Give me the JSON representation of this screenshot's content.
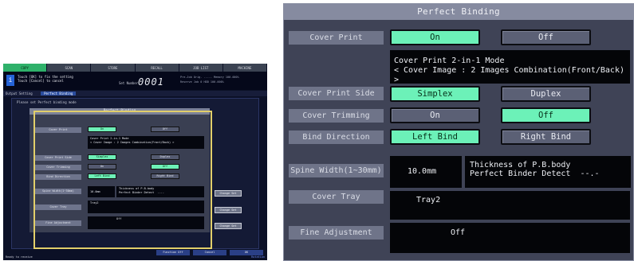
{
  "mini": {
    "tabs": [
      {
        "label": "COPY",
        "active": true
      },
      {
        "label": "SCAN",
        "active": false
      },
      {
        "label": "STORE",
        "active": false
      },
      {
        "label": "RECALL",
        "active": false
      },
      {
        "label": "JOB LIST",
        "active": false
      },
      {
        "label": "MACHINE",
        "active": false
      }
    ],
    "message_line1": "Touch [OK] to fix the setting",
    "message_line2": "Touch [Cancel] to cancel",
    "set_number_label": "Set Number",
    "set_number": "0001",
    "stat1": "Pre-Job Orig. -----   Memory   100.000%",
    "stat2": "Reserve Job     0  HDD      100.000%",
    "breadcrumb_parent": "Output Setting",
    "breadcrumb_current": "Perfect Binding",
    "hint": "Please set Perfect binding mode",
    "dialog_title": "Perfect Binding",
    "cover_print_label": "Cover Print",
    "on": "On",
    "off": "Off",
    "mode_line1": "Cover Print 2-in-1 Mode",
    "mode_line2": "< Cover Image : 2 Images Combination(Front/Back) >",
    "cover_print_side_label": "Cover Print Side",
    "simplex": "Simplex",
    "duplex": "Duplex",
    "cover_trimming_label": "Cover Trimming",
    "bind_direction_label": "Bind Direction",
    "left_bind": "Left Bind",
    "right_bind": "Right Bind",
    "spine_label": "Spine Width(1~30mm)",
    "spine_value": "10.0mm",
    "thickness_line1": "Thickness of P.B.body",
    "thickness_line2": "Perfect Binder Detect  --.-",
    "change_set": "Change Set",
    "cover_tray_label": "Cover Tray",
    "cover_tray_value": "Tray2",
    "fine_adj_label": "Fine Adjustment",
    "fine_adj_value": "Off",
    "function_off": "Function Off",
    "cancel": "Cancel",
    "ok": "OK",
    "ready": "Ready to receive",
    "rotation": "Rotation"
  },
  "dialog": {
    "title": "Perfect Binding",
    "cover_print": {
      "label": "Cover Print",
      "on": "On",
      "off": "Off",
      "selected": "On"
    },
    "mode_line1": "Cover Print 2-in-1 Mode",
    "mode_line2": "< Cover Image : 2 Images Combination(Front/Back) >",
    "cover_print_side": {
      "label": "Cover Print Side",
      "simplex": "Simplex",
      "duplex": "Duplex",
      "selected": "Simplex"
    },
    "cover_trimming": {
      "label": "Cover Trimming",
      "on": "On",
      "off": "Off",
      "selected": "Off"
    },
    "bind_direction": {
      "label": "Bind Direction",
      "left": "Left Bind",
      "right": "Right Bind",
      "selected": "Left Bind"
    },
    "spine_width": {
      "label": "Spine Width(1~30mm)",
      "value": "10.0mm"
    },
    "thickness": {
      "line1": "Thickness of P.B.body",
      "line2": "Perfect Binder Detect  --.-"
    },
    "cover_tray": {
      "label": "Cover Tray",
      "value": "Tray2"
    },
    "fine_adjustment": {
      "label": "Fine Adjustment",
      "value": "Off"
    }
  },
  "colors": {
    "selected": "#6cf1b8",
    "unselected": "#5b6075",
    "panel": "#3f4356",
    "label_bg": "#6f7489",
    "highlight_frame": "#e2cf6a"
  }
}
